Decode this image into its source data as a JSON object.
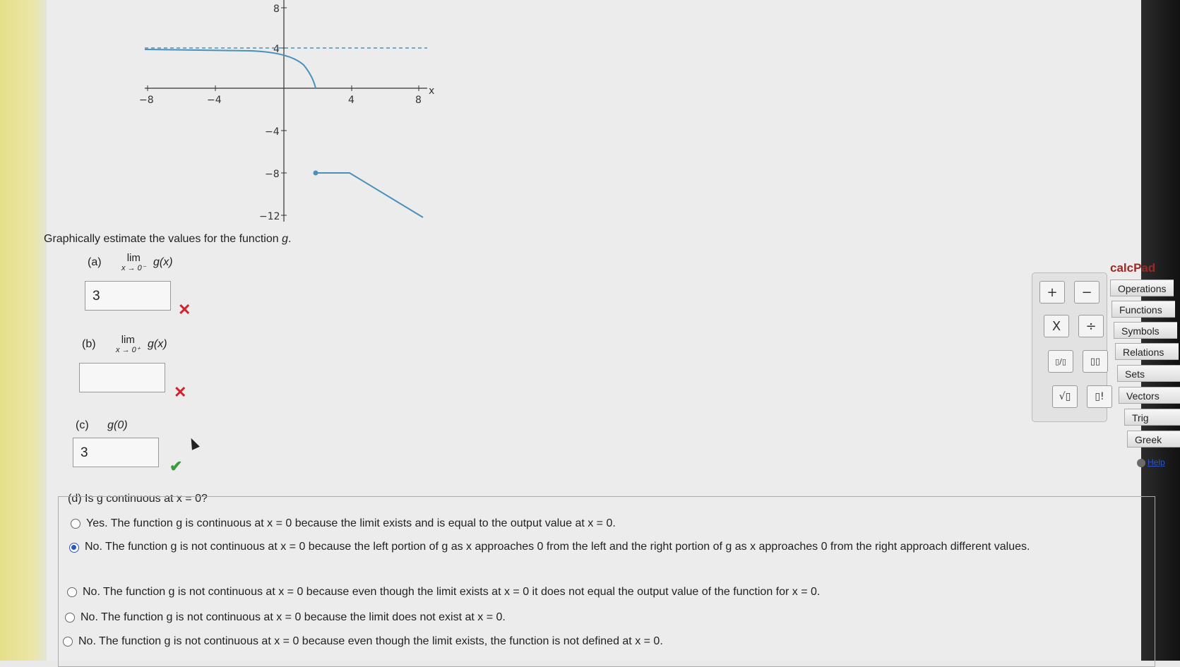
{
  "graph": {
    "x_label": "x",
    "x_ticks": [
      "−8",
      "−4",
      "4",
      "8"
    ],
    "y_ticks": [
      "8",
      "4",
      "−4",
      "−8",
      "−12"
    ]
  },
  "prompt": {
    "text_before": "Graphically estimate the values for the function ",
    "function_name": "g",
    "text_after": "."
  },
  "parts": {
    "a": {
      "label": "(a)",
      "lim": "lim",
      "sub": "x → 0⁻",
      "func": "g(x)",
      "answer": "3",
      "status": "incorrect"
    },
    "b": {
      "label": "(b)",
      "lim": "lim",
      "sub": "x → 0⁺",
      "func": "g(x)",
      "answer": "",
      "status": "incorrect"
    },
    "c": {
      "label": "(c)",
      "func": "g(0)",
      "answer": "3",
      "status": "correct"
    }
  },
  "marks": {
    "incorrect": "✕",
    "correct": "✔"
  },
  "question_d": "(d) Is g continuous at x = 0?",
  "options": [
    {
      "text": "Yes. The function g is continuous at x = 0 because the limit exists and is equal to the output value at x = 0.",
      "selected": false
    },
    {
      "text": "No. The function g is not continuous at x = 0 because the left portion of g as x approaches 0 from the left and the right portion of g as x approaches 0 from the right approach different values.",
      "selected": true
    },
    {
      "text": "No. The function g is not continuous at x = 0 because even though the limit exists at x = 0 it does not equal the output value of the function for x = 0.",
      "selected": false
    },
    {
      "text": "No. The function g is not continuous at x = 0 because the limit does not exist at x = 0.",
      "selected": false
    },
    {
      "text": "No. The function g is not continuous at x = 0 because even though the limit exists, the function is not defined at x = 0.",
      "selected": false
    }
  ],
  "calcpad": {
    "title": "calcPad",
    "keys": [
      "+",
      "−",
      "X",
      "÷",
      "▯/▯",
      "▯▯",
      "√▯",
      "▯!"
    ],
    "tabs": [
      "Operations",
      "Functions",
      "Symbols",
      "Relations",
      "Sets",
      "Vectors",
      "Trig",
      "Greek"
    ],
    "help": "Help"
  },
  "colors": {
    "curve": "#4a90b8",
    "incorrect": "#d4202a",
    "correct": "#3d9a3d",
    "accent": "#9a2a26"
  }
}
